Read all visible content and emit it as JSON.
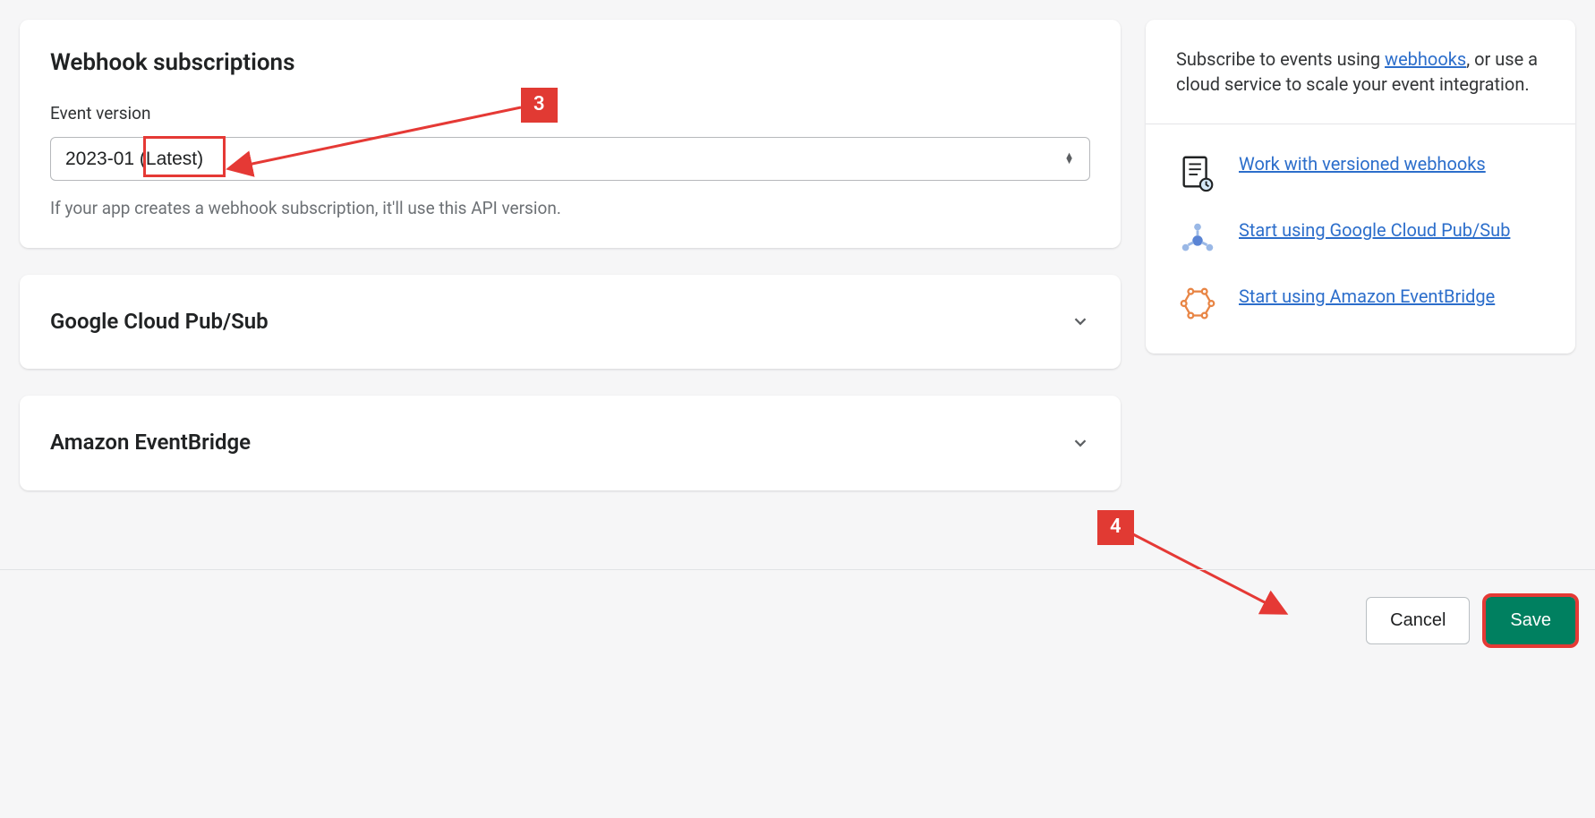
{
  "main": {
    "webhook_card": {
      "heading": "Webhook subscriptions",
      "field_label": "Event version",
      "select_value": "2023-01 (Latest)",
      "helper": "If your app creates a webhook subscription, it'll use this API version."
    },
    "pubsub_card": {
      "title": "Google Cloud Pub/Sub"
    },
    "eventbridge_card": {
      "title": "Amazon EventBridge"
    }
  },
  "sidebar": {
    "intro_prefix": "Subscribe to events using ",
    "intro_link": "webhooks",
    "intro_suffix": ", or use a cloud service to scale your event integration.",
    "links": [
      {
        "label": "Work with versioned webhooks"
      },
      {
        "label": "Start using Google Cloud Pub/Sub"
      },
      {
        "label": "Start using Amazon EventBridge"
      }
    ]
  },
  "footer": {
    "cancel": "Cancel",
    "save": "Save"
  },
  "annotations": {
    "badge3": "3",
    "badge4": "4"
  }
}
